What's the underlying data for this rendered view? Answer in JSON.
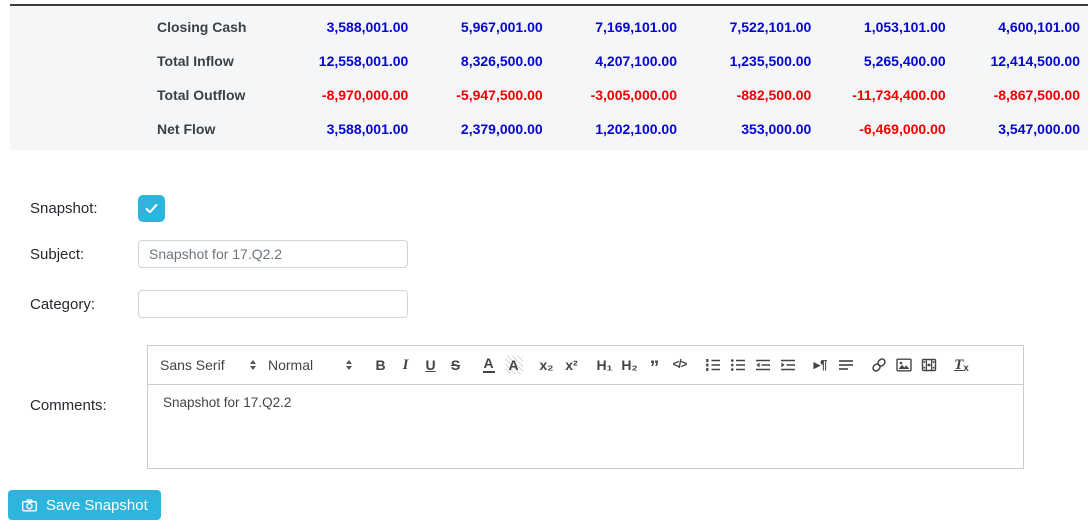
{
  "colors": {
    "accent": "#2eb5de",
    "positive": "#0505cf",
    "negative": "#f10000",
    "panel_bg": "#f5f6f8",
    "panel_top_border": "#383d42"
  },
  "table": {
    "rows": [
      {
        "label": "Closing Cash",
        "values": [
          "3,588,001.00",
          "5,967,001.00",
          "7,169,101.00",
          "7,522,101.00",
          "1,053,101.00",
          "4,600,101.00"
        ]
      },
      {
        "label": "Total Inflow",
        "values": [
          "12,558,001.00",
          "8,326,500.00",
          "4,207,100.00",
          "1,235,500.00",
          "5,265,400.00",
          "12,414,500.00"
        ]
      },
      {
        "label": "Total Outflow",
        "values": [
          "-8,970,000.00",
          "-5,947,500.00",
          "-3,005,000.00",
          "-882,500.00",
          "-11,734,400.00",
          "-8,867,500.00"
        ]
      },
      {
        "label": "Net Flow",
        "values": [
          "3,588,001.00",
          "2,379,000.00",
          "1,202,100.00",
          "353,000.00",
          "-6,469,000.00",
          "3,547,000.00"
        ]
      }
    ]
  },
  "form": {
    "snapshot_label": "Snapshot:",
    "snapshot_checked": true,
    "subject_label": "Subject:",
    "subject_value": "Snapshot for 17.Q2.2",
    "category_label": "Category:",
    "category_value": "",
    "comments_label": "Comments:",
    "comments_value": "Snapshot for 17.Q2.2"
  },
  "editor": {
    "font_label": "Sans Serif",
    "size_label": "Normal",
    "glyphs": {
      "bold": "B",
      "italic": "I",
      "underline": "U",
      "strike": "S",
      "color": "A",
      "background": "A",
      "subscript": "x₂",
      "superscript": "x²",
      "header1": "H₁",
      "header2": "H₂",
      "blockquote": "”",
      "code": "</>",
      "direction": "▸¶",
      "clean_base": "T",
      "clean_sub": "x"
    }
  },
  "save_button": {
    "label": "Save Snapshot"
  }
}
